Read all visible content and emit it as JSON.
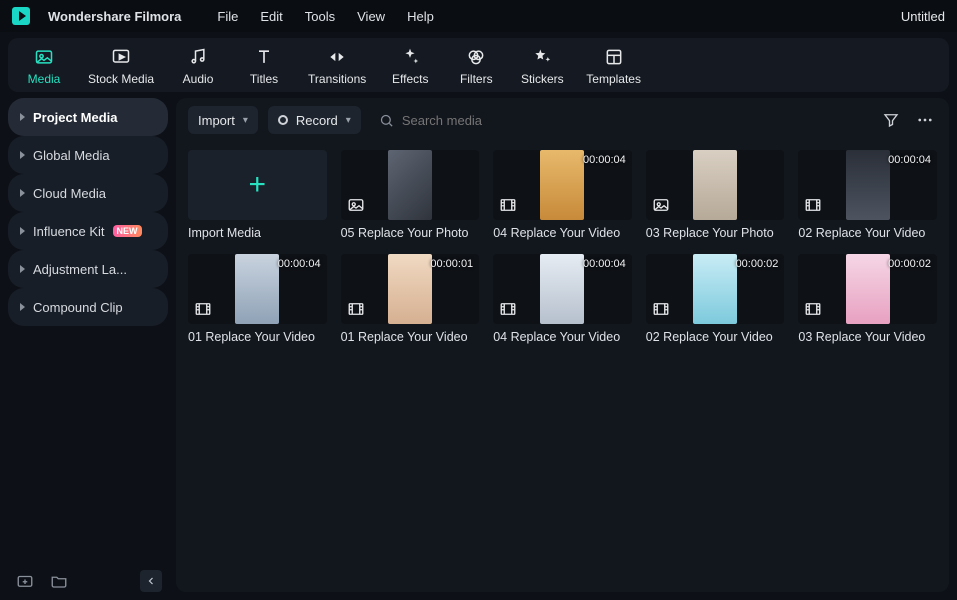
{
  "app": {
    "title": "Wondershare Filmora",
    "project": "Untitled"
  },
  "menu": [
    "File",
    "Edit",
    "Tools",
    "View",
    "Help"
  ],
  "tools": [
    {
      "id": "media",
      "label": "Media",
      "active": true
    },
    {
      "id": "stock-media",
      "label": "Stock Media"
    },
    {
      "id": "audio",
      "label": "Audio"
    },
    {
      "id": "titles",
      "label": "Titles"
    },
    {
      "id": "transitions",
      "label": "Transitions"
    },
    {
      "id": "effects",
      "label": "Effects"
    },
    {
      "id": "filters",
      "label": "Filters"
    },
    {
      "id": "stickers",
      "label": "Stickers"
    },
    {
      "id": "templates",
      "label": "Templates"
    }
  ],
  "sidebar": {
    "items": [
      {
        "label": "Project Media",
        "active": true
      },
      {
        "label": "Global Media"
      },
      {
        "label": "Cloud Media"
      },
      {
        "label": "Influence Kit",
        "badge": "NEW"
      },
      {
        "label": "Adjustment La..."
      },
      {
        "label": "Compound Clip"
      }
    ]
  },
  "contentbar": {
    "import": "Import",
    "record": "Record",
    "search_placeholder": "Search media"
  },
  "tiles": [
    {
      "kind": "import",
      "label": "Import Media"
    },
    {
      "kind": "photo",
      "label": "05 Replace Your Photo",
      "ph": "p1"
    },
    {
      "kind": "video",
      "label": "04 Replace Your Video",
      "duration": "00:00:04",
      "ph": "p2"
    },
    {
      "kind": "photo",
      "label": "03 Replace Your Photo",
      "ph": "p3"
    },
    {
      "kind": "video",
      "label": "02 Replace Your Video",
      "duration": "00:00:04",
      "ph": "p4"
    },
    {
      "kind": "video",
      "label": "01 Replace Your Video",
      "duration": "00:00:04",
      "ph": "p5"
    },
    {
      "kind": "video",
      "label": "01 Replace Your Video",
      "duration": "00:00:01",
      "ph": "p6"
    },
    {
      "kind": "video",
      "label": "04 Replace Your Video",
      "duration": "00:00:04",
      "ph": "p7"
    },
    {
      "kind": "video",
      "label": "02 Replace Your Video",
      "duration": "00:00:02",
      "ph": "p8"
    },
    {
      "kind": "video",
      "label": "03 Replace Your Video",
      "duration": "00:00:02",
      "ph": "p9"
    }
  ]
}
